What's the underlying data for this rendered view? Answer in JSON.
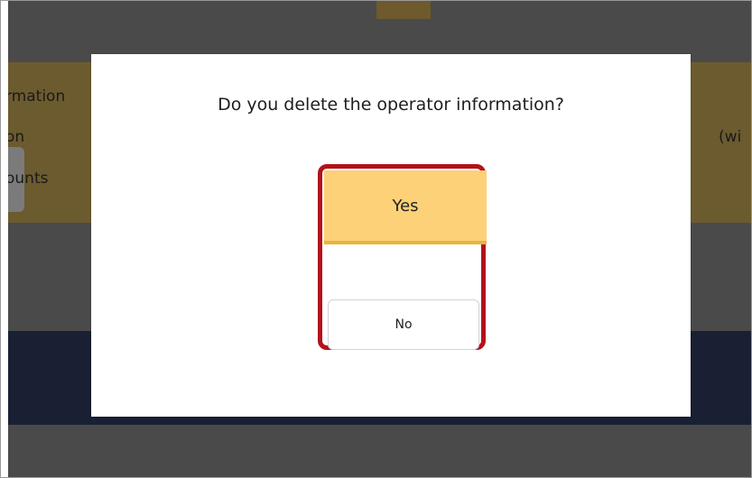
{
  "background": {
    "left_texts": [
      "rmation",
      "on",
      "ounts"
    ],
    "right_text": "(wi"
  },
  "dialog": {
    "message": "Do you delete the operator information?",
    "yes_label": "Yes",
    "no_label": "No"
  },
  "colors": {
    "yes_button": "#fcd177",
    "highlight_border": "#b3121b",
    "navy_band": "#1a2033"
  }
}
